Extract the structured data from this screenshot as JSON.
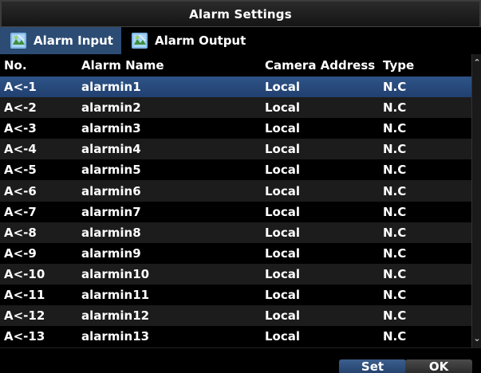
{
  "window": {
    "title": "Alarm Settings"
  },
  "tabs": [
    {
      "label": "Alarm Input",
      "icon": "alarm-input-icon",
      "active": true
    },
    {
      "label": "Alarm Output",
      "icon": "alarm-output-icon",
      "active": false
    }
  ],
  "table": {
    "columns": [
      "No.",
      "Alarm Name",
      "Camera Address",
      "Type"
    ],
    "selected_index": 0,
    "rows": [
      {
        "no": "A<-1",
        "name": "alarmin1",
        "camera_address": "Local",
        "type": "N.C"
      },
      {
        "no": "A<-2",
        "name": "alarmin2",
        "camera_address": "Local",
        "type": "N.C"
      },
      {
        "no": "A<-3",
        "name": "alarmin3",
        "camera_address": "Local",
        "type": "N.C"
      },
      {
        "no": "A<-4",
        "name": "alarmin4",
        "camera_address": "Local",
        "type": "N.C"
      },
      {
        "no": "A<-5",
        "name": "alarmin5",
        "camera_address": "Local",
        "type": "N.C"
      },
      {
        "no": "A<-6",
        "name": "alarmin6",
        "camera_address": "Local",
        "type": "N.C"
      },
      {
        "no": "A<-7",
        "name": "alarmin7",
        "camera_address": "Local",
        "type": "N.C"
      },
      {
        "no": "A<-8",
        "name": "alarmin8",
        "camera_address": "Local",
        "type": "N.C"
      },
      {
        "no": "A<-9",
        "name": "alarmin9",
        "camera_address": "Local",
        "type": "N.C"
      },
      {
        "no": "A<-10",
        "name": "alarmin10",
        "camera_address": "Local",
        "type": "N.C"
      },
      {
        "no": "A<-11",
        "name": "alarmin11",
        "camera_address": "Local",
        "type": "N.C"
      },
      {
        "no": "A<-12",
        "name": "alarmin12",
        "camera_address": "Local",
        "type": "N.C"
      },
      {
        "no": "A<-13",
        "name": "alarmin13",
        "camera_address": "Local",
        "type": "N.C"
      }
    ]
  },
  "footer": {
    "set_label": "Set",
    "ok_label": "OK"
  },
  "colors": {
    "selection": "#2c4c74",
    "stripe": "#1c1c1c",
    "background": "#000000",
    "text": "#ffffff"
  }
}
